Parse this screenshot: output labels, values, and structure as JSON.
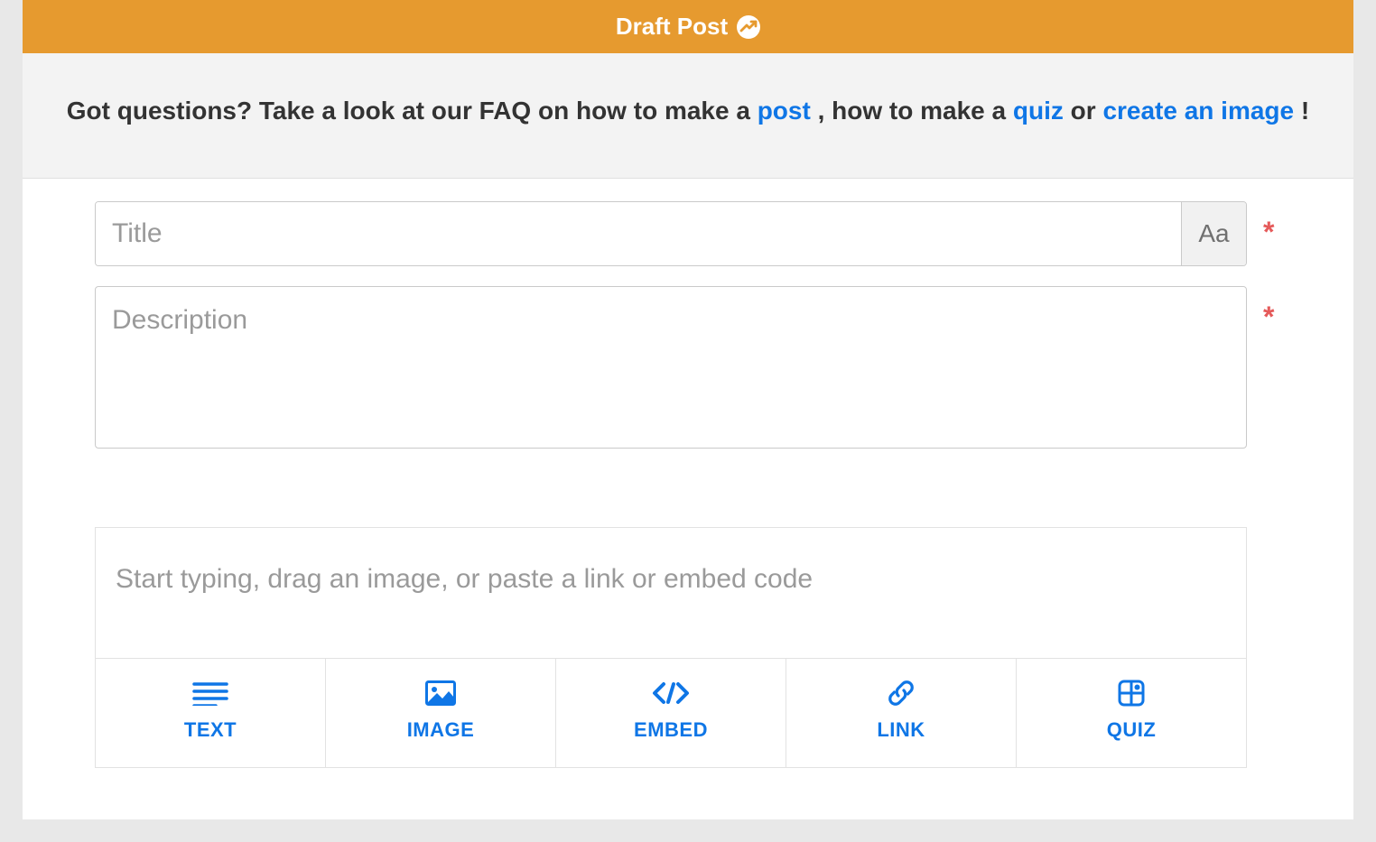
{
  "banner": {
    "title": "Draft Post"
  },
  "faq": {
    "prefix": "Got questions? Take a look at our FAQ on how to make a ",
    "link_post": "post",
    "mid1": " , how to make a ",
    "link_quiz": "quiz",
    "mid2": " or ",
    "link_image": "create an image",
    "suffix": " !"
  },
  "fields": {
    "title_placeholder": "Title",
    "aa_label": "Aa",
    "description_placeholder": "Description",
    "content_placeholder": "Start typing, drag an image, or paste a link or embed code",
    "required": "*"
  },
  "toolbar": {
    "text": "TEXT",
    "image": "IMAGE",
    "embed": "EMBED",
    "link": "LINK",
    "quiz": "QUIZ"
  },
  "colors": {
    "accent_orange": "#e69a2f",
    "link_blue": "#0f76e6",
    "required_red": "#e55a5a"
  }
}
